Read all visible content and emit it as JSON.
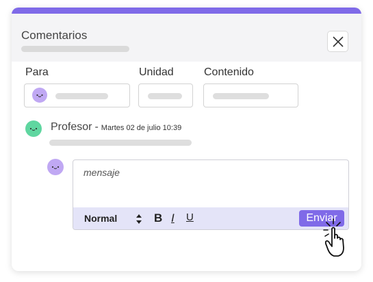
{
  "colors": {
    "accent": "#7f6ae8",
    "avatar_purple": "#c0a8f3",
    "avatar_green": "#5fd6a0",
    "toolbar_bg": "#e4e4f8"
  },
  "header": {
    "title": "Comentarios",
    "close_icon": "close-icon"
  },
  "filters": {
    "to_label": "Para",
    "unit_label": "Unidad",
    "content_label": "Contenido"
  },
  "comment": {
    "author": "Profesor",
    "separator": "-",
    "date": "Martes 02 de julio 10:39"
  },
  "editor": {
    "placeholder": "mensaje",
    "style_select": "Normal",
    "bold": "B",
    "italic": "I",
    "underline": "U",
    "send_label": "Enviar"
  }
}
